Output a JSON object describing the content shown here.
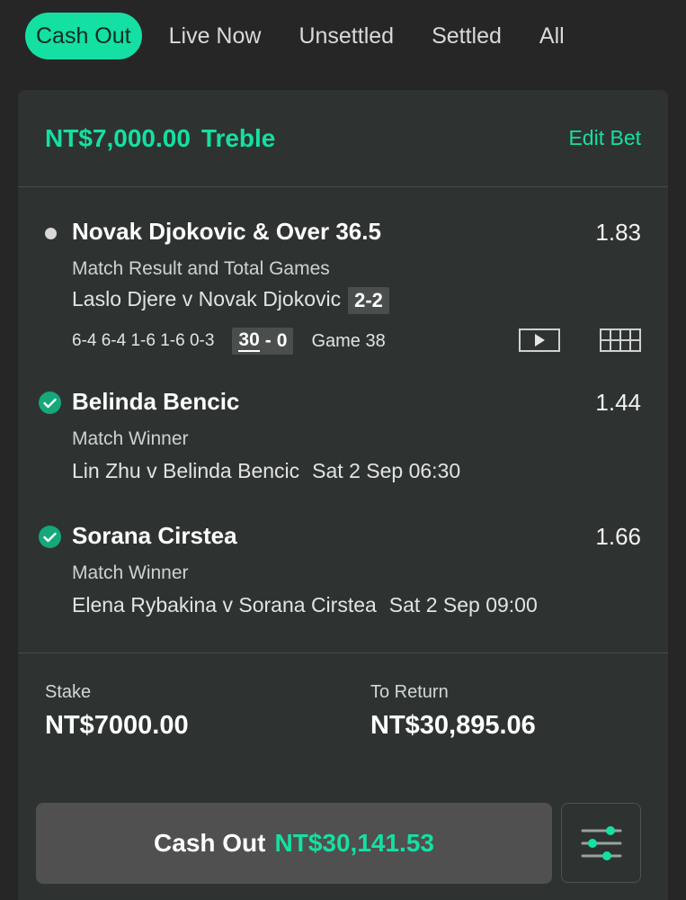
{
  "tabs": [
    {
      "label": "Cash Out",
      "active": true
    },
    {
      "label": "Live Now",
      "active": false
    },
    {
      "label": "Unsettled",
      "active": false
    },
    {
      "label": "Settled",
      "active": false
    },
    {
      "label": "All",
      "active": false
    }
  ],
  "bet": {
    "stake_amount": "NT$7,000.00",
    "bet_type": "Treble",
    "edit_label": "Edit Bet"
  },
  "selections": [
    {
      "name": "Novak Djokovic & Over 36.5",
      "odds": "1.83",
      "market": "Match Result and Total Games",
      "event": "Laslo Djere v Novak Djokovic",
      "sets_score": "2-2",
      "set_scores": "6-4 6-4 1-6 1-6 0-3",
      "point_home": "30",
      "point_sep": "-",
      "point_away": "0",
      "game": "Game 38",
      "status_icon": "pending-dot-icon"
    },
    {
      "name": "Belinda Bencic",
      "odds": "1.44",
      "market": "Match Winner",
      "event": "Lin Zhu v Belinda Bencic",
      "time": "Sat 2 Sep 06:30",
      "status_icon": "check-icon"
    },
    {
      "name": "Sorana Cirstea",
      "odds": "1.66",
      "market": "Match Winner",
      "event": "Elena Rybakina v Sorana Cirstea",
      "time": "Sat 2 Sep 09:00",
      "status_icon": "check-icon"
    }
  ],
  "summary": {
    "stake_label": "Stake",
    "stake_value": "NT$7000.00",
    "return_label": "To Return",
    "return_value": "NT$30,895.06"
  },
  "cashout": {
    "label": "Cash Out",
    "amount": "NT$30,141.53"
  },
  "colors": {
    "accent": "#14e0a3",
    "background": "#262626",
    "card": "#2e3331",
    "check": "#14a87a"
  }
}
